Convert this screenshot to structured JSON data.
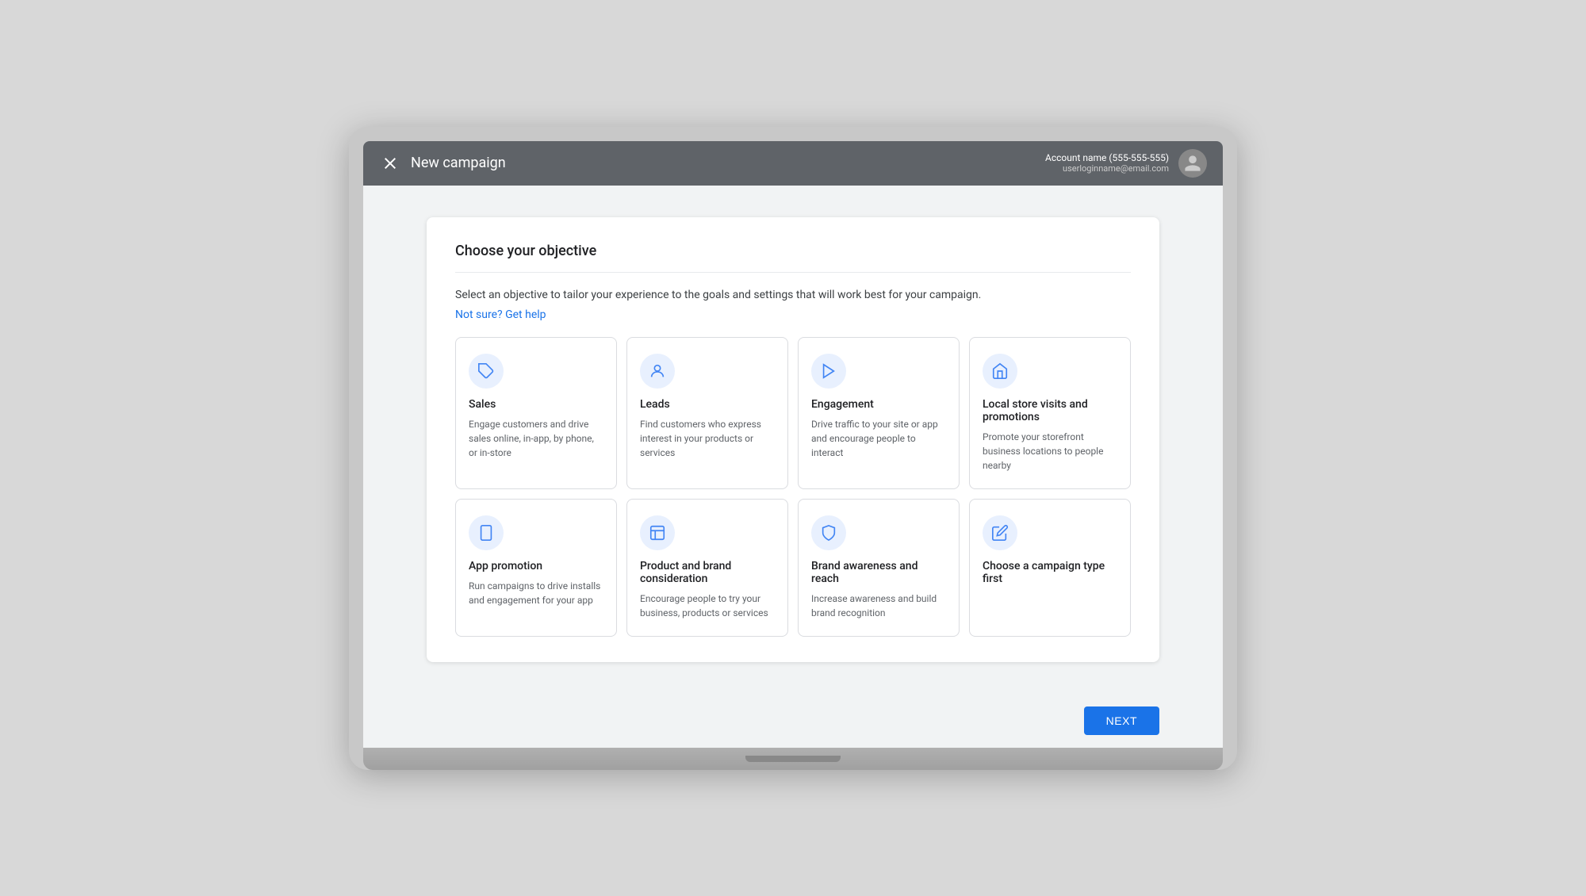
{
  "topBar": {
    "title": "New campaign",
    "closeIcon": "×",
    "accountName": "Account name (555-555-555)",
    "accountEmail": "userloginname@email.com",
    "avatarLabel": "👤"
  },
  "page": {
    "cardTitle": "Choose your objective",
    "description": "Select an objective to tailor your experience to the goals and settings that will work best for your campaign.",
    "helpLinkText": "Not sure? Get help",
    "nextButton": "NEXT"
  },
  "objectives": [
    {
      "id": "sales",
      "title": "Sales",
      "description": "Engage customers and drive sales online, in-app, by phone, or in-store",
      "iconType": "tag"
    },
    {
      "id": "leads",
      "title": "Leads",
      "description": "Find customers who express interest in your products or services",
      "iconType": "person"
    },
    {
      "id": "engagement",
      "title": "Engagement",
      "description": "Drive traffic to your site or app and encourage people to interact",
      "iconType": "cursor"
    },
    {
      "id": "local-store",
      "title": "Local store visits and promotions",
      "description": "Promote your storefront business locations to people nearby",
      "iconType": "store"
    },
    {
      "id": "app-promotion",
      "title": "App promotion",
      "description": "Run campaigns to drive installs and engagement for your app",
      "iconType": "phone"
    },
    {
      "id": "product-brand",
      "title": "Product and brand consideration",
      "description": "Encourage people to try your business, products or services",
      "iconType": "document"
    },
    {
      "id": "brand-awareness",
      "title": "Brand awareness and reach",
      "description": "Increase awareness and build brand recognition",
      "iconType": "shield"
    },
    {
      "id": "campaign-type",
      "title": "Choose a campaign type first",
      "description": "",
      "iconType": "pencil"
    }
  ]
}
